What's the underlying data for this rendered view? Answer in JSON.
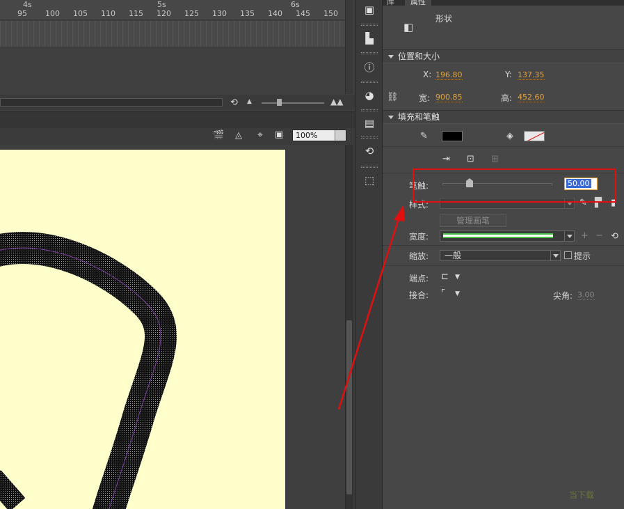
{
  "timeline": {
    "seconds": [
      "4s",
      "5s",
      "6s"
    ],
    "frames": [
      "95",
      "100",
      "105",
      "110",
      "115",
      "120",
      "125",
      "130",
      "135",
      "140",
      "145",
      "150"
    ]
  },
  "stage": {
    "zoom": "100%",
    "canvas_color": "#ffffcc"
  },
  "icon_strip": [
    "library-panel-icon",
    "align-panel-icon",
    "info-panel-icon",
    "color-swatches-icon",
    "align-objects-icon",
    "motion-presets-icon",
    "transform-icon"
  ],
  "props": {
    "tabs": [
      "库",
      "属性"
    ],
    "object_type": "形状",
    "position_size": {
      "header": "位置和大小",
      "x_label": "X:",
      "x": "196.80",
      "y_label": "Y:",
      "y": "137.35",
      "w_label": "宽:",
      "w": "900.85",
      "h_label": "高:",
      "h": "452.60"
    },
    "fill_stroke": {
      "header": "填充和笔触",
      "stroke_color": "#000000",
      "stroke_label": "笔触:",
      "stroke_value": "50.00",
      "style_label": "样式:",
      "manage_brush": "管理画笔",
      "width_label": "宽度:",
      "scale_label": "缩放:",
      "scale_value": "一般",
      "hint_label": "提示",
      "cap_label": "端点:",
      "join_label": "接合:",
      "miter_label": "尖角:",
      "miter_value": "3.00"
    },
    "watermark": "当下载"
  },
  "annotation_color": "#e01010"
}
